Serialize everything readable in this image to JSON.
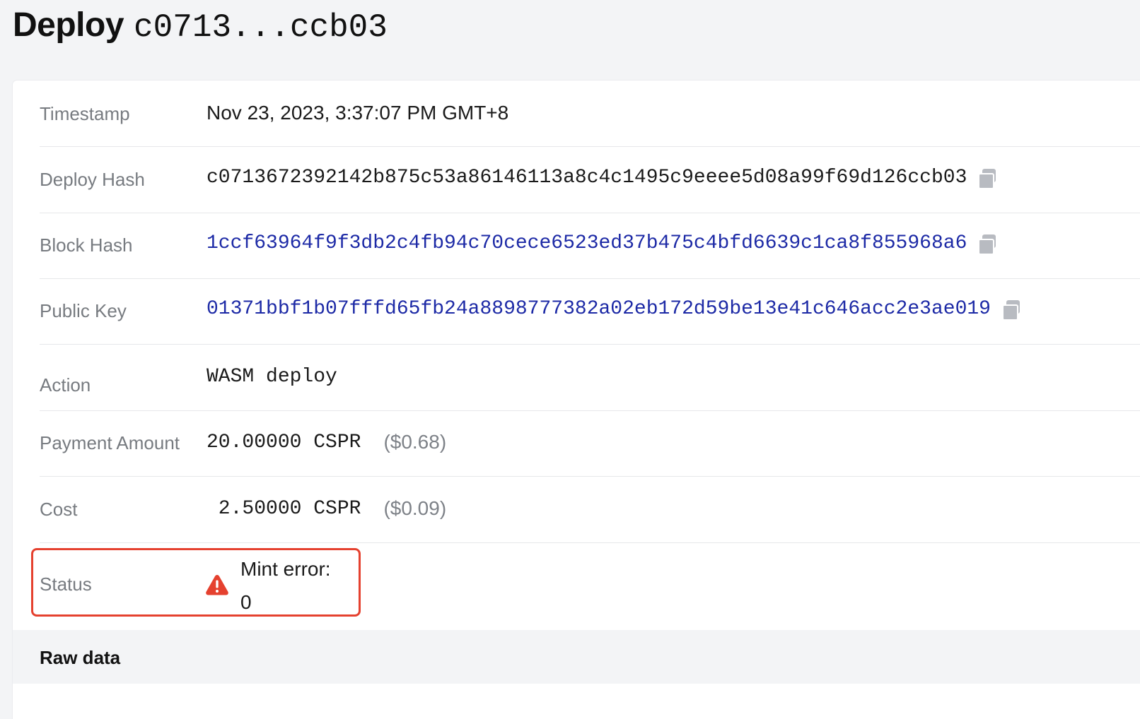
{
  "header": {
    "title_word": "Deploy",
    "title_hash": "c0713...ccb03"
  },
  "details": {
    "timestamp": {
      "label": "Timestamp",
      "value": "Nov 23, 2023, 3:37:07 PM GMT+8"
    },
    "deploy_hash": {
      "label": "Deploy Hash",
      "value": "c0713672392142b875c53a86146113a8c4c1495c9eeee5d08a99f69d126ccb03",
      "copy_icon": "copy-icon"
    },
    "block_hash": {
      "label": "Block Hash",
      "value": "1ccf63964f9f3db2c4fb94c70cece6523ed37b475c4bfd6639c1ca8f855968a6",
      "copy_icon": "copy-icon"
    },
    "public_key": {
      "label": "Public Key",
      "value": "01371bbf1b07fffd65fb24a8898777382a02eb172d59be13e41c646acc2e3ae019",
      "copy_icon": "copy-icon"
    },
    "action": {
      "label": "Action",
      "value": "WASM deploy"
    },
    "payment_amount": {
      "label": "Payment Amount",
      "value": "20.00000 CSPR",
      "usd": "($0.68)"
    },
    "cost": {
      "label": "Cost",
      "value": " 2.50000 CSPR",
      "usd": "($0.09)"
    },
    "status": {
      "label": "Status",
      "value": "Mint error: 0",
      "icon": "warning-icon",
      "highlight_color": "#e5412f"
    }
  },
  "raw_data": {
    "label": "Raw data"
  },
  "colors": {
    "link": "#1d2aa6",
    "label": "#777b80",
    "error": "#e5412f",
    "background": "#f3f4f6"
  }
}
